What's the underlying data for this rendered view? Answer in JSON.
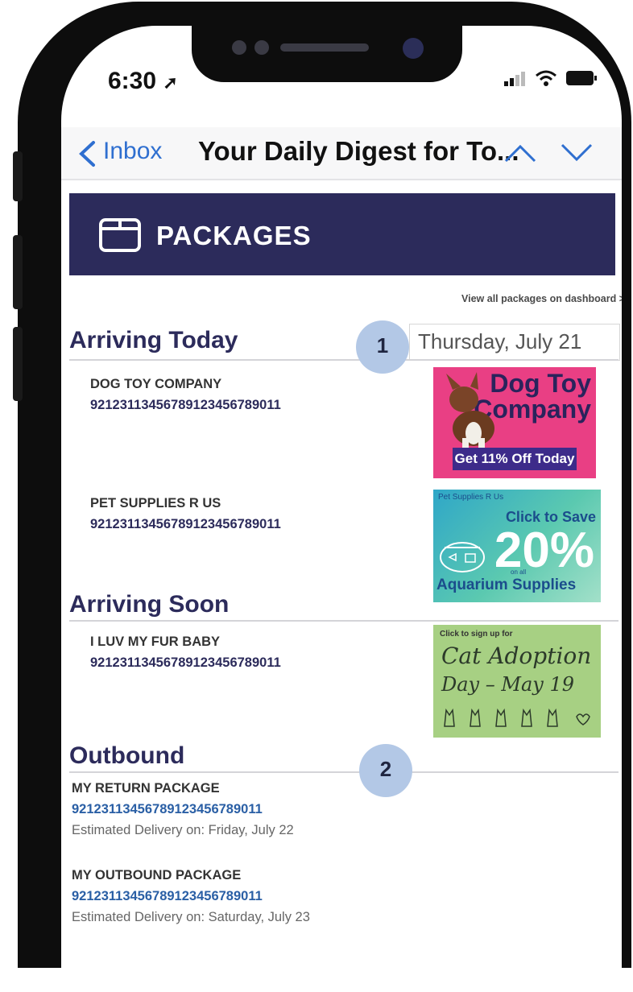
{
  "status_bar": {
    "time": "6:30"
  },
  "nav": {
    "back_label": "Inbox",
    "title": "Your Daily Digest for To..."
  },
  "banner": {
    "title": "PACKAGES"
  },
  "dashboard_link": "View all packages on dashboard >",
  "arriving_today": {
    "heading": "Arriving Today",
    "date": "Thursday, July 21",
    "badge": "1",
    "items": [
      {
        "name": "DOG TOY COMPANY",
        "tracking": "9212311345678912345678901​1"
      },
      {
        "name": "PET SUPPLIES R US",
        "tracking": "92123113456789123456789011"
      }
    ]
  },
  "arriving_soon": {
    "heading": "Arriving Soon",
    "items": [
      {
        "name": "I LUV MY FUR BABY",
        "tracking": "92123113456789123456789011"
      }
    ]
  },
  "outbound": {
    "heading": "Outbound",
    "badge": "2",
    "items": [
      {
        "name": "MY RETURN PACKAGE",
        "tracking": "92123113456789123456789011",
        "estimate": "Estimated Delivery on: Friday, July 22"
      },
      {
        "name": "MY OUTBOUND PACKAGE",
        "tracking": "92123113456789123456789011",
        "estimate": "Estimated Delivery on: Saturday, July 23"
      }
    ]
  },
  "ads": {
    "dog": {
      "line1": "Dog Toy",
      "line2": "Company",
      "offer": "Get 11% Off Today"
    },
    "pet": {
      "small": "Pet Supplies R Us",
      "save": "Click to Save",
      "percent": "20%",
      "on_all": "on all",
      "category": "Aquarium Supplies"
    },
    "cat": {
      "small": "Click to sign up for",
      "line1": "Cat Adoption",
      "line2": "Day – May 19"
    }
  },
  "colors": {
    "navy": "#2c2b5b",
    "link_blue": "#2a5fa5",
    "ios_blue": "#2f6fd0",
    "badge": "#b3c8e6"
  },
  "icons": [
    "location-arrow-icon",
    "signal-icon",
    "wifi-icon",
    "battery-icon",
    "chevron-left-icon",
    "chevron-up-icon",
    "chevron-down-icon",
    "package-box-icon",
    "fishbowl-icon",
    "cat-silhouette-icon",
    "heart-icon"
  ]
}
